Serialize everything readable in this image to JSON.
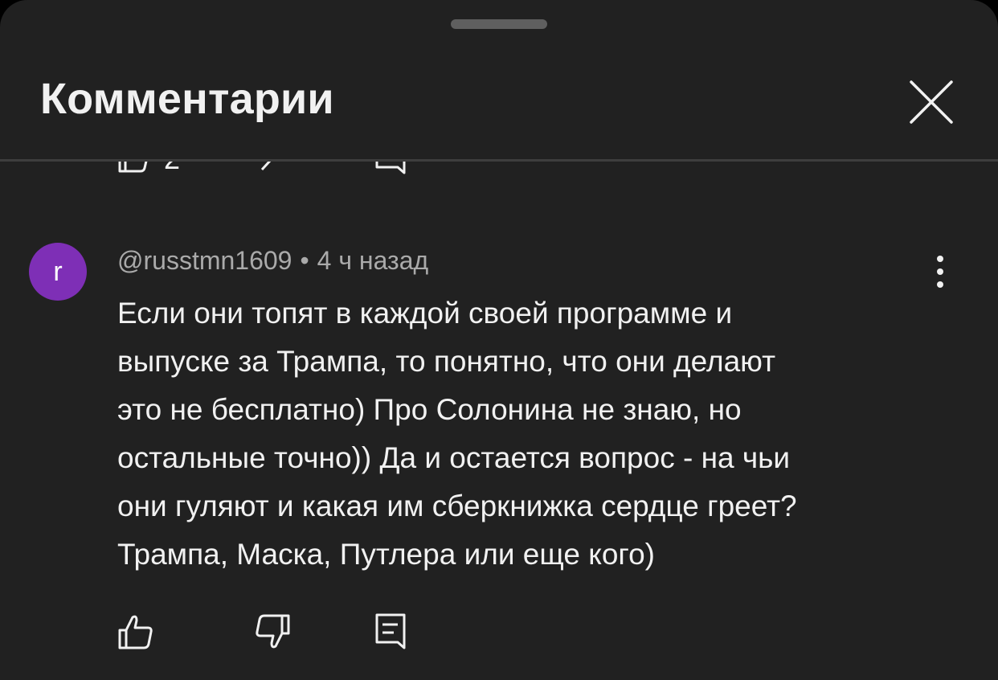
{
  "header": {
    "title": "Комментарии",
    "close_icon": "close-icon"
  },
  "previous_comment": {
    "like_count": "2"
  },
  "comment": {
    "avatar_letter": "r",
    "avatar_color": "#7e2fb6",
    "author": "@russtmn1609",
    "separator": "•",
    "time": "4 ч назад",
    "text_lines": [
      "Если они топят в каждой своей программе и",
      "выпуске за Трампа, то понятно, что они делают",
      "это не бесплатно) Про Солонина не знаю, но",
      "остальные точно)) Да и остается вопрос - на чьи",
      "они гуляют и какая им сберкнижка сердце греет?",
      "Трампа, Маска, Путлера или еще кого)"
    ],
    "actions": {
      "like_icon": "thumbs-up-icon",
      "dislike_icon": "thumbs-down-icon",
      "reply_icon": "reply-icon",
      "more_icon": "more-vertical-icon"
    }
  }
}
